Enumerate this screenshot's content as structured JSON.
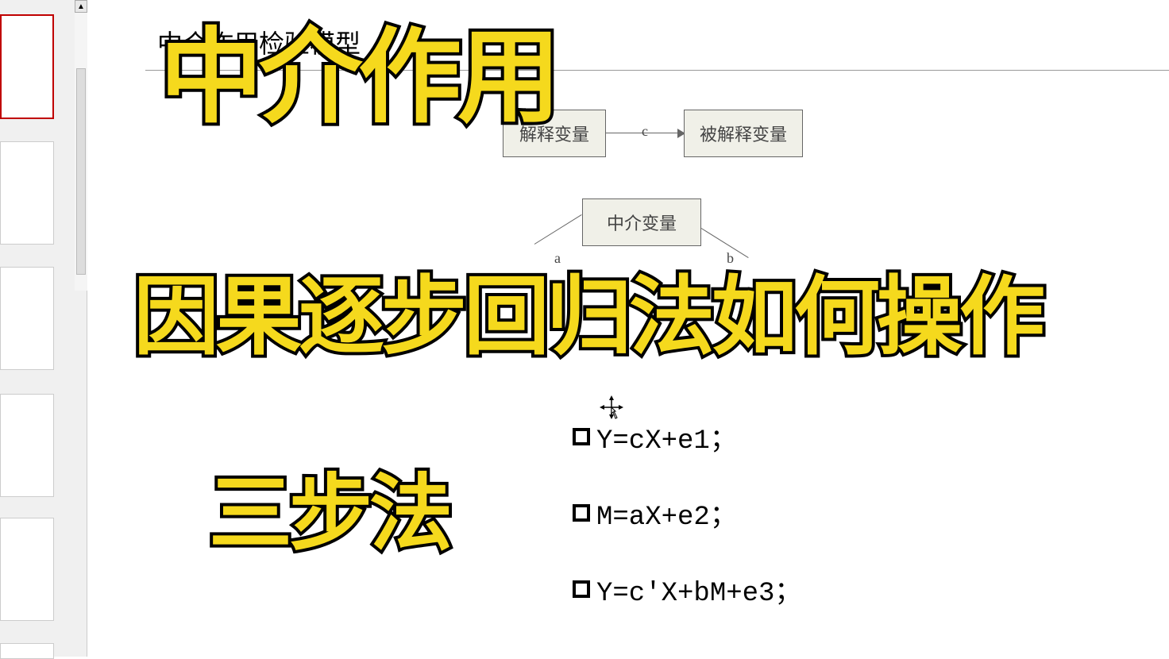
{
  "slide": {
    "title": "中介作用检验模型",
    "overlay_title_1": "中介作用",
    "overlay_title_2": "因果逐步回归法如何操作",
    "overlay_title_3": "三步法",
    "diagram": {
      "box_explain": "解释变量",
      "box_explained": "被解释变量",
      "box_mediator": "中介变量",
      "label_c": "c",
      "label_a": "a",
      "label_b": "b"
    },
    "equations": {
      "eq1": "Y=cX+e1；",
      "eq2": "M=aX+e2；",
      "eq3": "Y=c'X+bM+e3；"
    }
  },
  "thumbnails": {
    "scroll_up": "▲"
  }
}
